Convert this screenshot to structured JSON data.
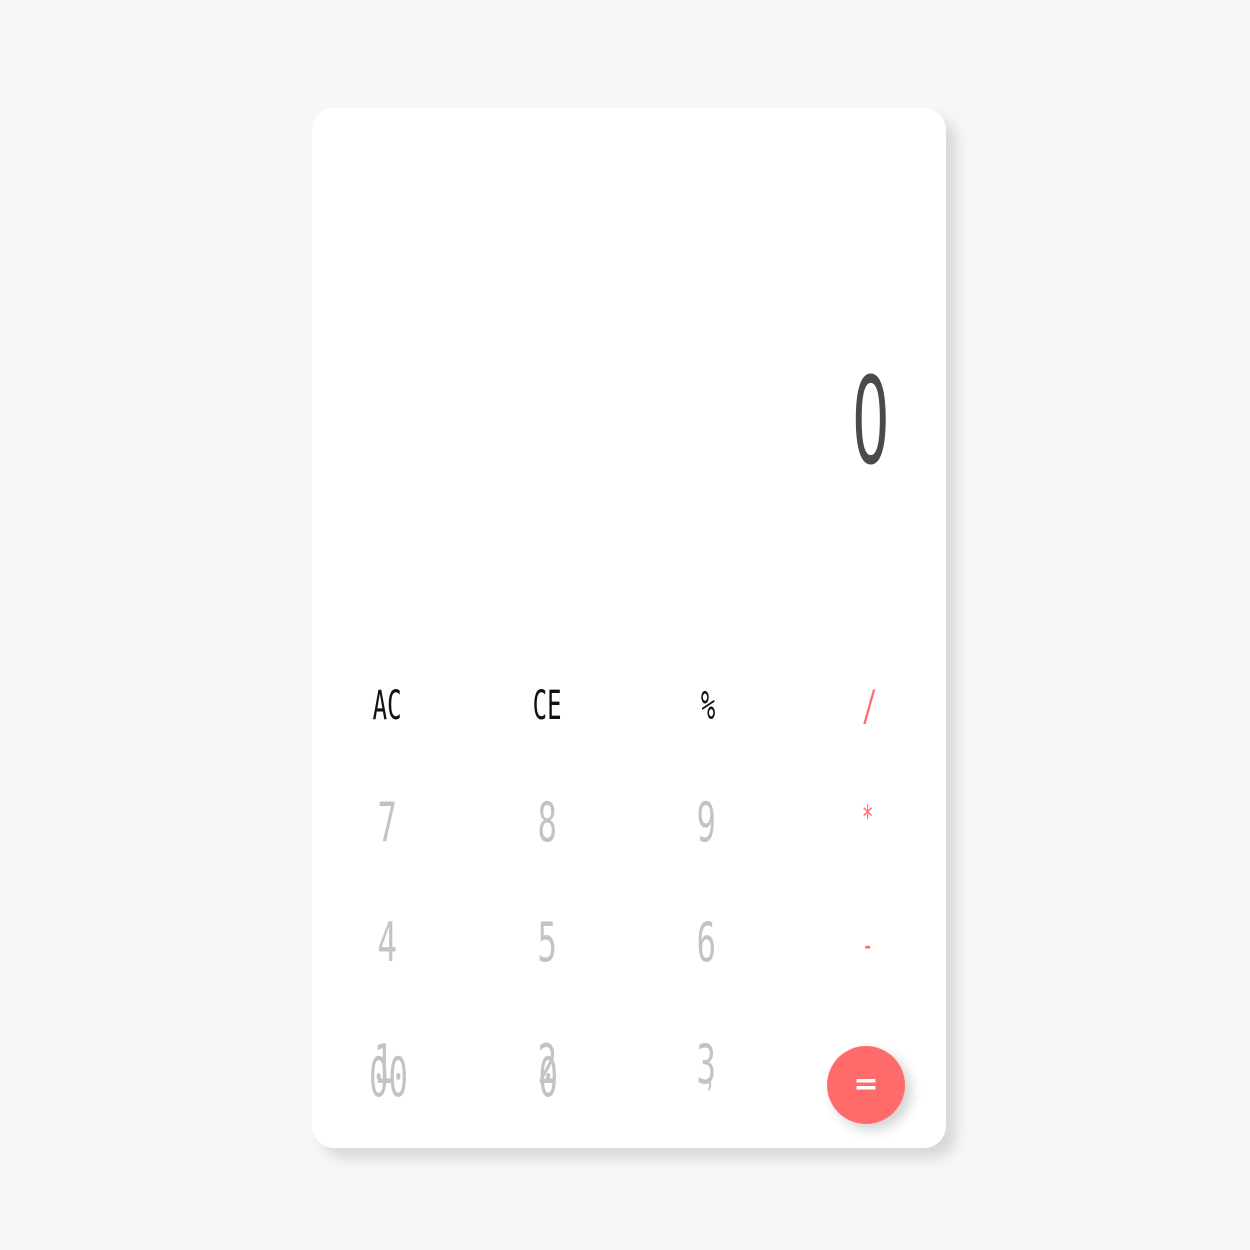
{
  "display": {
    "value": "0"
  },
  "keys": {
    "ac": "AC",
    "ce": "CE",
    "percent": "%",
    "divide": "/",
    "seven": "7",
    "eight": "8",
    "nine": "9",
    "multiply": "*",
    "four": "4",
    "five": "5",
    "six": "6",
    "subtract": "-",
    "one": "1",
    "two": "2",
    "three": "3",
    "add": "+",
    "double_zero": "00",
    "zero": "0",
    "decimal": ",",
    "equals": "="
  },
  "colors": {
    "background": "#f7f7f7",
    "panel": "#ffffff",
    "accent": "#ff6b6b",
    "function_text": "#111111",
    "number_text": "#c3c3c3",
    "display_text": "#4a4a4a"
  }
}
